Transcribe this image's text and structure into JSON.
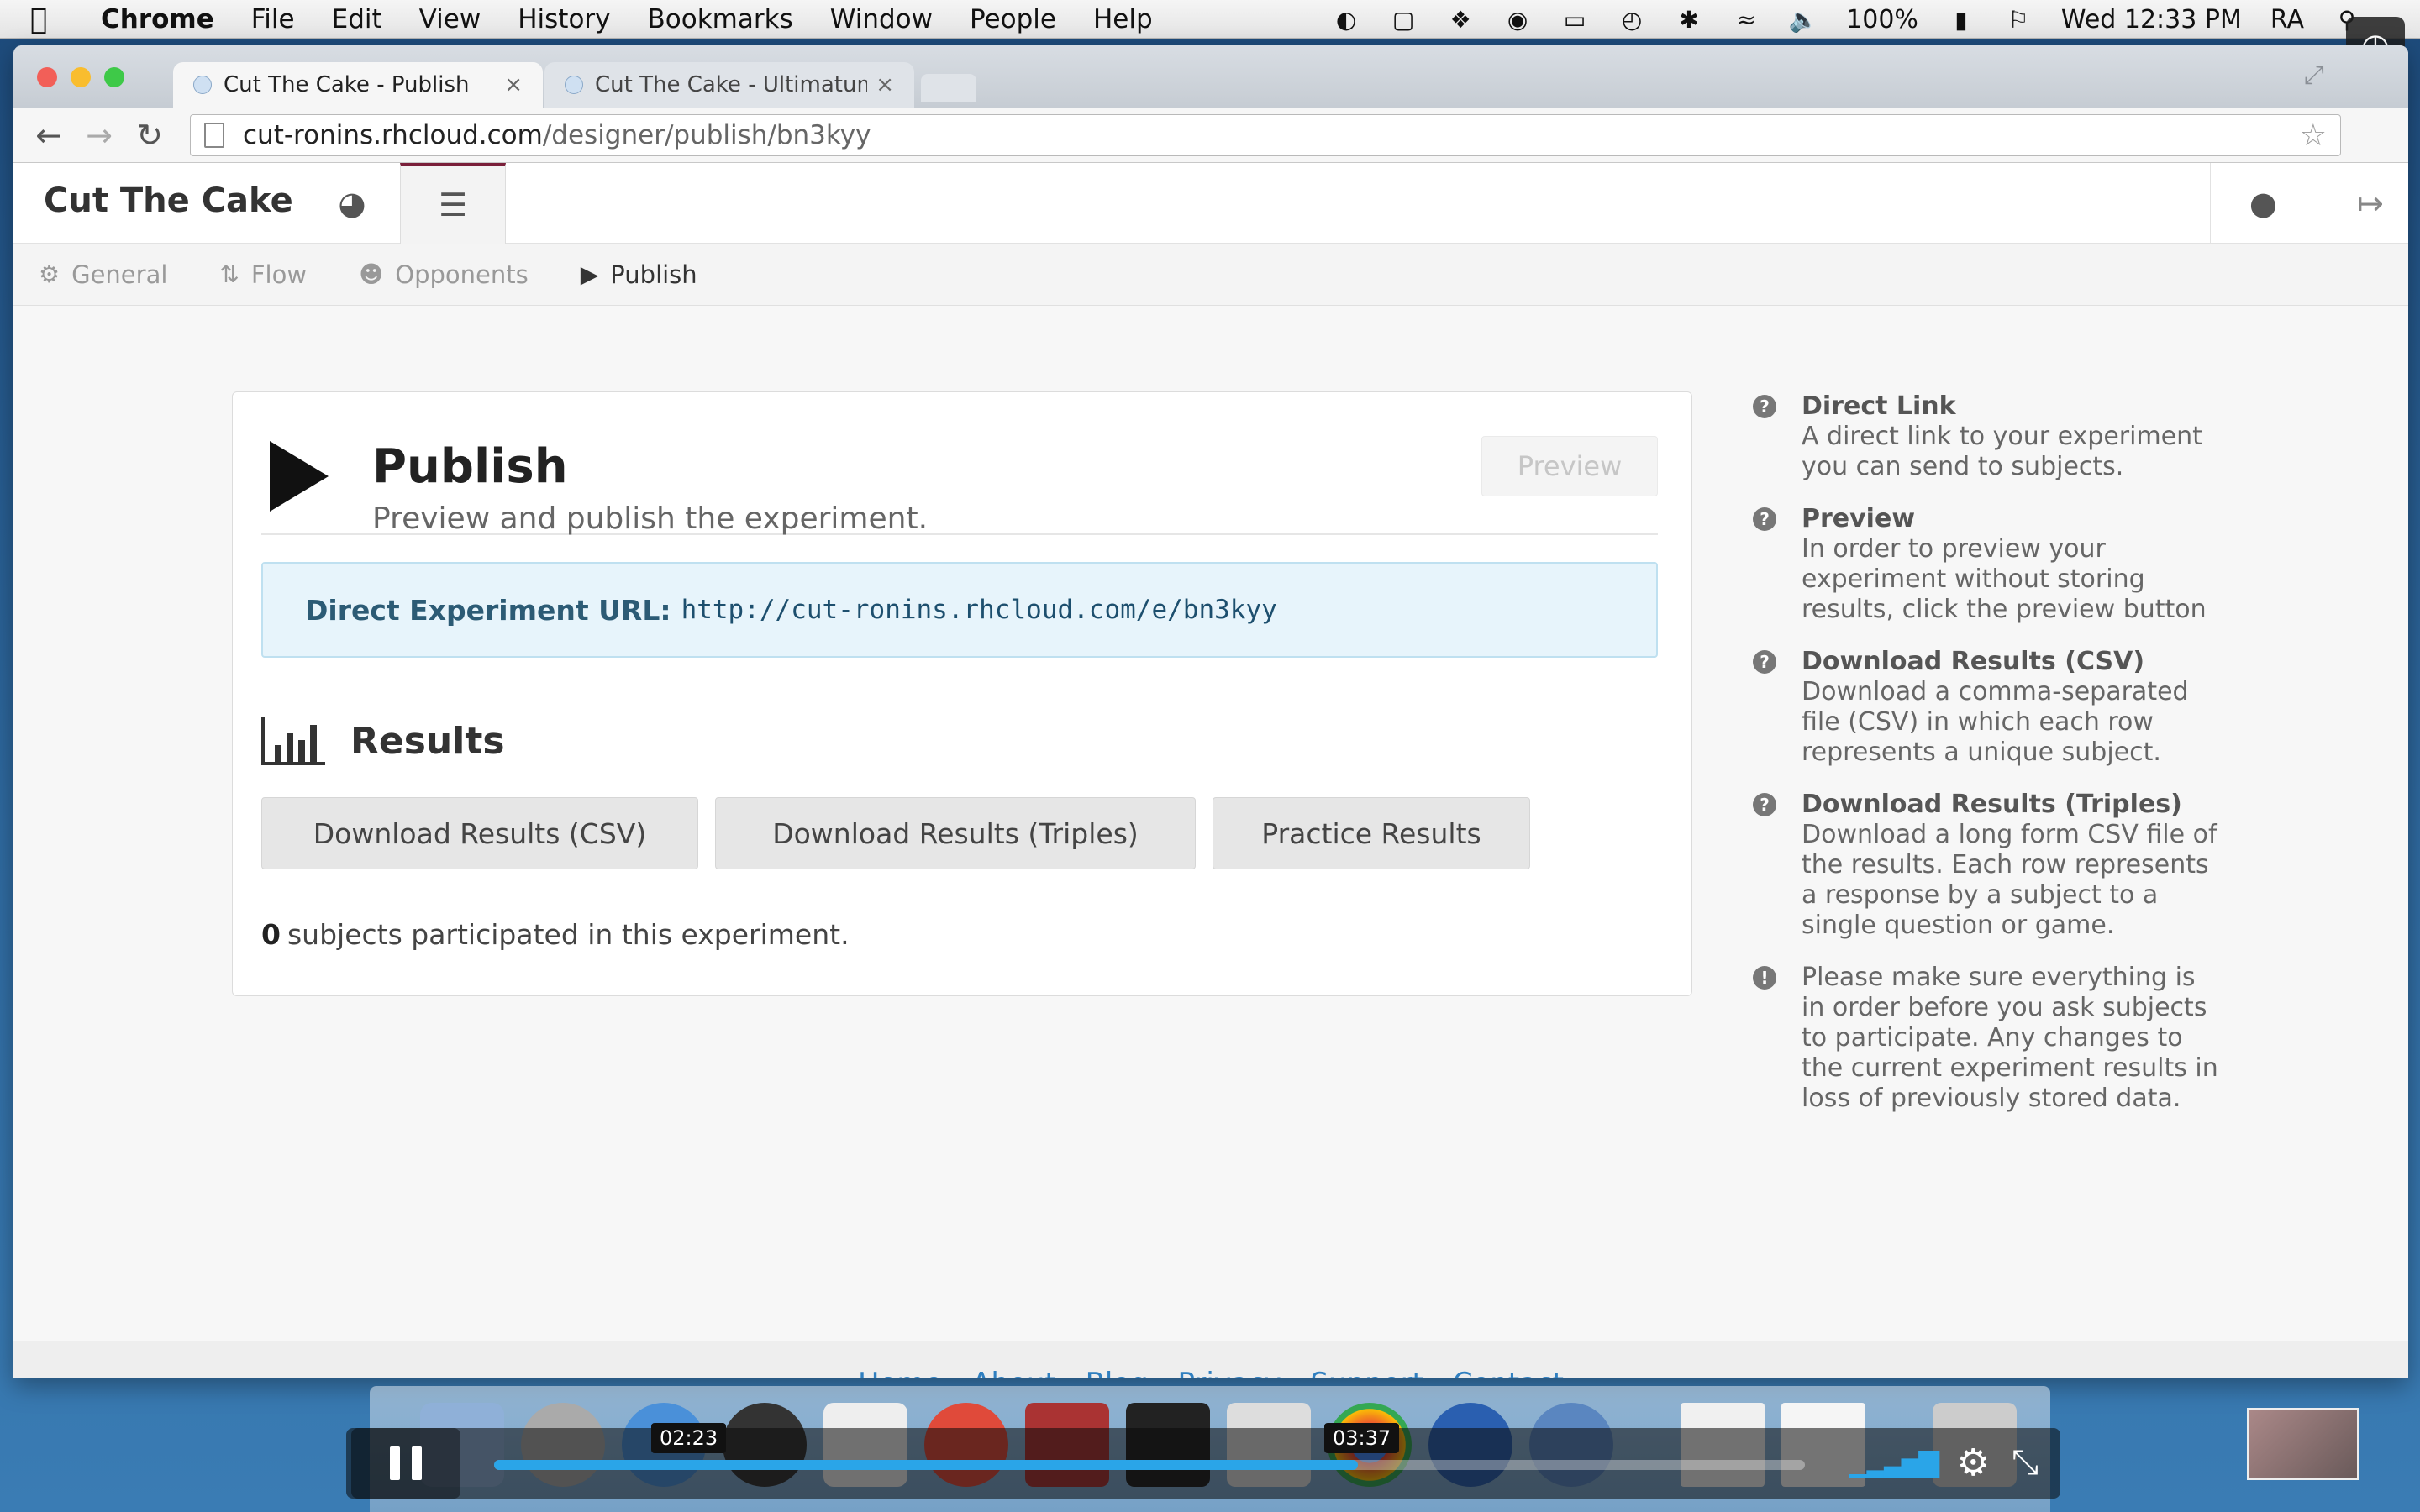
{
  "menubar": {
    "app": "Chrome",
    "items": [
      "File",
      "Edit",
      "View",
      "History",
      "Bookmarks",
      "Window",
      "People",
      "Help"
    ],
    "battery": "100%",
    "clock": "Wed 12:33 PM",
    "user": "RA"
  },
  "browser": {
    "tabs": [
      {
        "title": "Cut The Cake - Publish"
      },
      {
        "title": "Cut The Cake - Ultimatum"
      }
    ],
    "address": {
      "host": "cut-ronins.rhcloud.com",
      "path": "/designer/publish/bn3kyy"
    }
  },
  "app": {
    "brand": "Cut The Cake",
    "subnav": [
      "General",
      "Flow",
      "Opponents",
      "Publish"
    ]
  },
  "panel": {
    "title": "Publish",
    "subtitle": "Preview and publish the experiment.",
    "preview_label": "Preview",
    "url_label": "Direct Experiment URL:",
    "url": "http://cut-ronins.rhcloud.com/e/bn3kyy",
    "results_title": "Results",
    "buttons": {
      "csv": "Download Results (CSV)",
      "triples": "Download Results (Triples)",
      "practice": "Practice Results"
    },
    "participation_count": "0",
    "participation_text": "subjects participated in this experiment."
  },
  "help": [
    {
      "title": "Direct Link",
      "text": "A direct link to your experiment you can send to subjects."
    },
    {
      "title": "Preview",
      "text": "In order to preview your experiment without storing results, click the preview button"
    },
    {
      "title": "Download Results (CSV)",
      "text": "Download a comma-separated file (CSV) in which each row represents a unique subject."
    },
    {
      "title": "Download Results (Triples)",
      "text": "Download a long form CSV file of the results. Each row represents a response by a subject to a single question or game."
    },
    {
      "title": "",
      "text": "Please make sure everything is in order before you ask subjects to participate. Any changes to the current experiment results in loss of previously stored data."
    }
  ],
  "footer": [
    "Home",
    "About",
    "Blog",
    "Privacy",
    "Support",
    "Contact"
  ],
  "video": {
    "current": "02:23",
    "total": "03:37",
    "progress_fraction": 0.659
  },
  "colors": {
    "link": "#2f7fc0",
    "active_tab_accent": "#7a1f3a",
    "progress": "#2aa5e8"
  }
}
